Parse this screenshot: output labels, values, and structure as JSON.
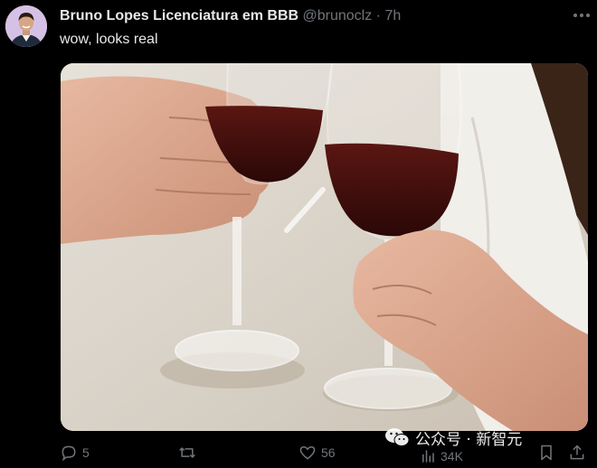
{
  "tweet": {
    "display_name": "Bruno Lopes Licenciatura em BBB",
    "handle": "@brunoclz",
    "separator": "·",
    "time": "7h",
    "text": "wow, looks real"
  },
  "actions": {
    "replies": "5",
    "likes": "56",
    "views": "34K"
  },
  "watermark": {
    "text": "公众号 · 新智元"
  },
  "icons": {
    "reply": "reply-icon",
    "retweet": "retweet-icon",
    "like": "heart-icon",
    "views": "views-icon",
    "bookmark": "bookmark-icon",
    "share": "share-icon",
    "more": "more-icon"
  },
  "colors": {
    "background": "#000000",
    "primary_text": "#e7e9ea",
    "secondary_text": "#71767b"
  }
}
